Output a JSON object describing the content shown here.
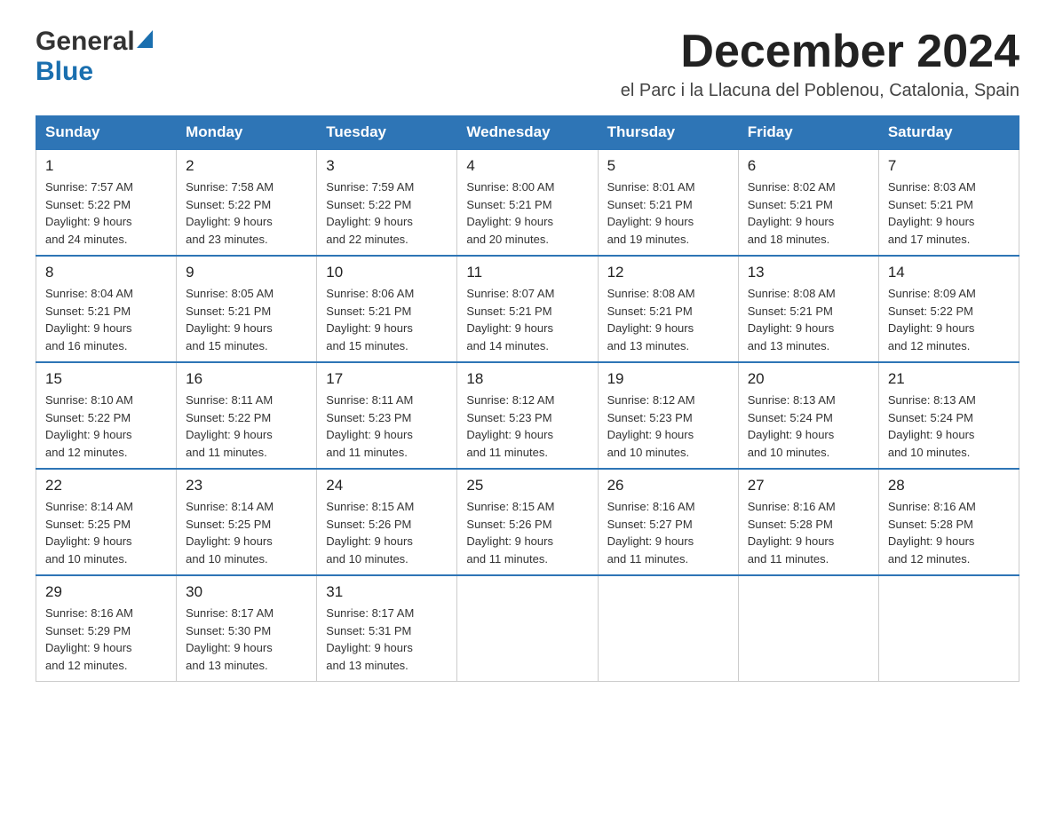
{
  "logo": {
    "general": "General",
    "blue": "Blue"
  },
  "title": {
    "month": "December 2024",
    "location": "el Parc i la Llacuna del Poblenou, Catalonia, Spain"
  },
  "weekdays": [
    "Sunday",
    "Monday",
    "Tuesday",
    "Wednesday",
    "Thursday",
    "Friday",
    "Saturday"
  ],
  "weeks": [
    [
      {
        "day": "1",
        "sunrise": "7:57 AM",
        "sunset": "5:22 PM",
        "daylight": "9 hours and 24 minutes."
      },
      {
        "day": "2",
        "sunrise": "7:58 AM",
        "sunset": "5:22 PM",
        "daylight": "9 hours and 23 minutes."
      },
      {
        "day": "3",
        "sunrise": "7:59 AM",
        "sunset": "5:22 PM",
        "daylight": "9 hours and 22 minutes."
      },
      {
        "day": "4",
        "sunrise": "8:00 AM",
        "sunset": "5:21 PM",
        "daylight": "9 hours and 20 minutes."
      },
      {
        "day": "5",
        "sunrise": "8:01 AM",
        "sunset": "5:21 PM",
        "daylight": "9 hours and 19 minutes."
      },
      {
        "day": "6",
        "sunrise": "8:02 AM",
        "sunset": "5:21 PM",
        "daylight": "9 hours and 18 minutes."
      },
      {
        "day": "7",
        "sunrise": "8:03 AM",
        "sunset": "5:21 PM",
        "daylight": "9 hours and 17 minutes."
      }
    ],
    [
      {
        "day": "8",
        "sunrise": "8:04 AM",
        "sunset": "5:21 PM",
        "daylight": "9 hours and 16 minutes."
      },
      {
        "day": "9",
        "sunrise": "8:05 AM",
        "sunset": "5:21 PM",
        "daylight": "9 hours and 15 minutes."
      },
      {
        "day": "10",
        "sunrise": "8:06 AM",
        "sunset": "5:21 PM",
        "daylight": "9 hours and 15 minutes."
      },
      {
        "day": "11",
        "sunrise": "8:07 AM",
        "sunset": "5:21 PM",
        "daylight": "9 hours and 14 minutes."
      },
      {
        "day": "12",
        "sunrise": "8:08 AM",
        "sunset": "5:21 PM",
        "daylight": "9 hours and 13 minutes."
      },
      {
        "day": "13",
        "sunrise": "8:08 AM",
        "sunset": "5:21 PM",
        "daylight": "9 hours and 13 minutes."
      },
      {
        "day": "14",
        "sunrise": "8:09 AM",
        "sunset": "5:22 PM",
        "daylight": "9 hours and 12 minutes."
      }
    ],
    [
      {
        "day": "15",
        "sunrise": "8:10 AM",
        "sunset": "5:22 PM",
        "daylight": "9 hours and 12 minutes."
      },
      {
        "day": "16",
        "sunrise": "8:11 AM",
        "sunset": "5:22 PM",
        "daylight": "9 hours and 11 minutes."
      },
      {
        "day": "17",
        "sunrise": "8:11 AM",
        "sunset": "5:23 PM",
        "daylight": "9 hours and 11 minutes."
      },
      {
        "day": "18",
        "sunrise": "8:12 AM",
        "sunset": "5:23 PM",
        "daylight": "9 hours and 11 minutes."
      },
      {
        "day": "19",
        "sunrise": "8:12 AM",
        "sunset": "5:23 PM",
        "daylight": "9 hours and 10 minutes."
      },
      {
        "day": "20",
        "sunrise": "8:13 AM",
        "sunset": "5:24 PM",
        "daylight": "9 hours and 10 minutes."
      },
      {
        "day": "21",
        "sunrise": "8:13 AM",
        "sunset": "5:24 PM",
        "daylight": "9 hours and 10 minutes."
      }
    ],
    [
      {
        "day": "22",
        "sunrise": "8:14 AM",
        "sunset": "5:25 PM",
        "daylight": "9 hours and 10 minutes."
      },
      {
        "day": "23",
        "sunrise": "8:14 AM",
        "sunset": "5:25 PM",
        "daylight": "9 hours and 10 minutes."
      },
      {
        "day": "24",
        "sunrise": "8:15 AM",
        "sunset": "5:26 PM",
        "daylight": "9 hours and 10 minutes."
      },
      {
        "day": "25",
        "sunrise": "8:15 AM",
        "sunset": "5:26 PM",
        "daylight": "9 hours and 11 minutes."
      },
      {
        "day": "26",
        "sunrise": "8:16 AM",
        "sunset": "5:27 PM",
        "daylight": "9 hours and 11 minutes."
      },
      {
        "day": "27",
        "sunrise": "8:16 AM",
        "sunset": "5:28 PM",
        "daylight": "9 hours and 11 minutes."
      },
      {
        "day": "28",
        "sunrise": "8:16 AM",
        "sunset": "5:28 PM",
        "daylight": "9 hours and 12 minutes."
      }
    ],
    [
      {
        "day": "29",
        "sunrise": "8:16 AM",
        "sunset": "5:29 PM",
        "daylight": "9 hours and 12 minutes."
      },
      {
        "day": "30",
        "sunrise": "8:17 AM",
        "sunset": "5:30 PM",
        "daylight": "9 hours and 13 minutes."
      },
      {
        "day": "31",
        "sunrise": "8:17 AM",
        "sunset": "5:31 PM",
        "daylight": "9 hours and 13 minutes."
      },
      null,
      null,
      null,
      null
    ]
  ],
  "labels": {
    "sunrise": "Sunrise:",
    "sunset": "Sunset:",
    "daylight": "Daylight:"
  }
}
